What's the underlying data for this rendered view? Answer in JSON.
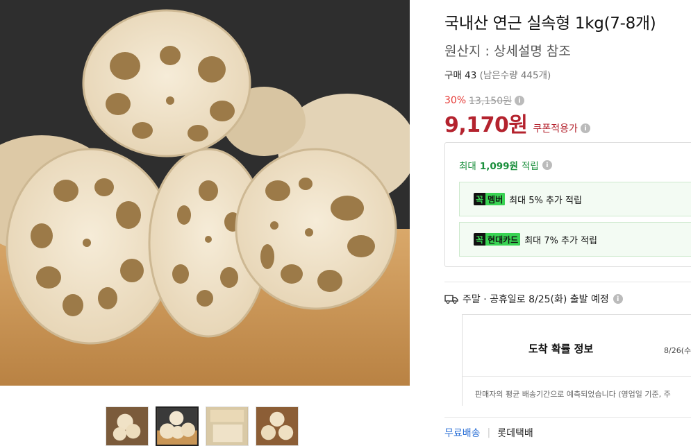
{
  "product": {
    "title": "국내산 연근 실속형 1kg(7-8개)",
    "origin": "원산지 : 상세설명 참조",
    "purchase_count": "구매 43",
    "remaining": "(남은수량 445개)"
  },
  "pricing": {
    "discount_rate": "30%",
    "original_price": "13,150원",
    "sale_price": "9,170원",
    "sale_note": "쿠폰적용가"
  },
  "rewards": {
    "max_label": "최대",
    "max_amount": "1,099원",
    "max_suffix": "적립",
    "items": [
      {
        "tag": "멤버",
        "text": "최대 5% 추가 적립"
      },
      {
        "tag": "현대카드",
        "text": "최대 7% 추가 적립"
      }
    ],
    "tag_prefix": "꼭"
  },
  "shipping": {
    "notice": "주말 · 공휴일로 8/25(화) 출발 예정",
    "arrival_title": "도착 확률 정보",
    "arrival_date": "8/26(수",
    "arrival_note": "판매자의 평균 배송기간으로 예측되었습니다 (영업일 기준, 주",
    "free_shipping": "무료배송",
    "separator": "|",
    "courier": "롯데택배"
  },
  "icons": {
    "info": "info-icon",
    "truck": "truck-icon"
  },
  "colors": {
    "price_red": "#b4232e",
    "discount_red": "#e53935",
    "reward_green": "#1a8f3c",
    "tag_green": "#39d353",
    "link_blue": "#2a6fd6"
  }
}
